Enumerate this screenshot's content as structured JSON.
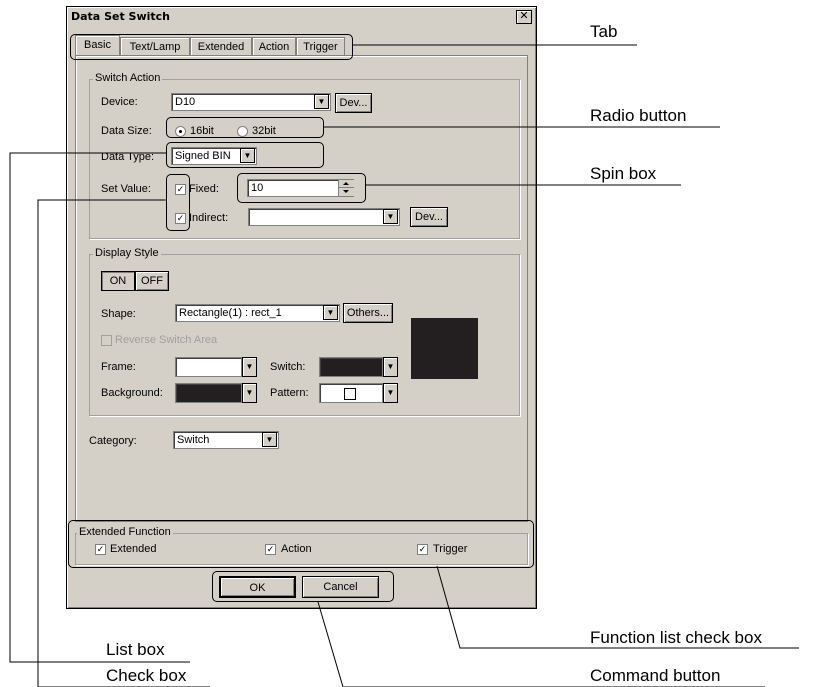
{
  "dialog": {
    "title": "Data Set Switch",
    "close_glyph": "✕",
    "tabs": [
      "Basic",
      "Text/Lamp",
      "Extended",
      "Action",
      "Trigger"
    ],
    "switch_action": {
      "legend": "Switch Action",
      "device_label": "Device:",
      "device_value": "D10",
      "dev_button": "Dev...",
      "data_size_label": "Data Size:",
      "size_16": "16bit",
      "size_32": "32bit",
      "data_type_label": "Data Type:",
      "data_type_value": "Signed BIN",
      "set_value_label": "Set Value:",
      "fixed_label": "Fixed:",
      "fixed_value": "10",
      "indirect_label": "Indirect:",
      "indirect_dev_button": "Dev..."
    },
    "display_style": {
      "legend": "Display Style",
      "on_button": "ON",
      "off_button": "OFF",
      "shape_label": "Shape:",
      "shape_value": "Rectangle(1) : rect_1",
      "others_button": "Others...",
      "reverse_label": "Reverse Switch Area",
      "frame_label": "Frame:",
      "switch_label": "Switch:",
      "background_label": "Background:",
      "pattern_label": "Pattern:",
      "frame_color": "#ffffff",
      "switch_color": "#231f20",
      "background_color": "#231f20",
      "preview_color": "#231f20"
    },
    "category_label": "Category:",
    "category_value": "Switch",
    "extended_function": {
      "legend": "Extended Function",
      "extended": "Extended",
      "action": "Action",
      "trigger": "Trigger"
    },
    "ok_button": "OK",
    "cancel_button": "Cancel",
    "check_glyph": "✓",
    "arrow_glyph": "▼"
  },
  "annotations": {
    "tab": "Tab",
    "radio_button": "Radio button",
    "spin_box": "Spin box",
    "list_box": "List box",
    "check_box": "Check box",
    "function_list_check_box": "Function list check box",
    "command_button": "Command button"
  }
}
